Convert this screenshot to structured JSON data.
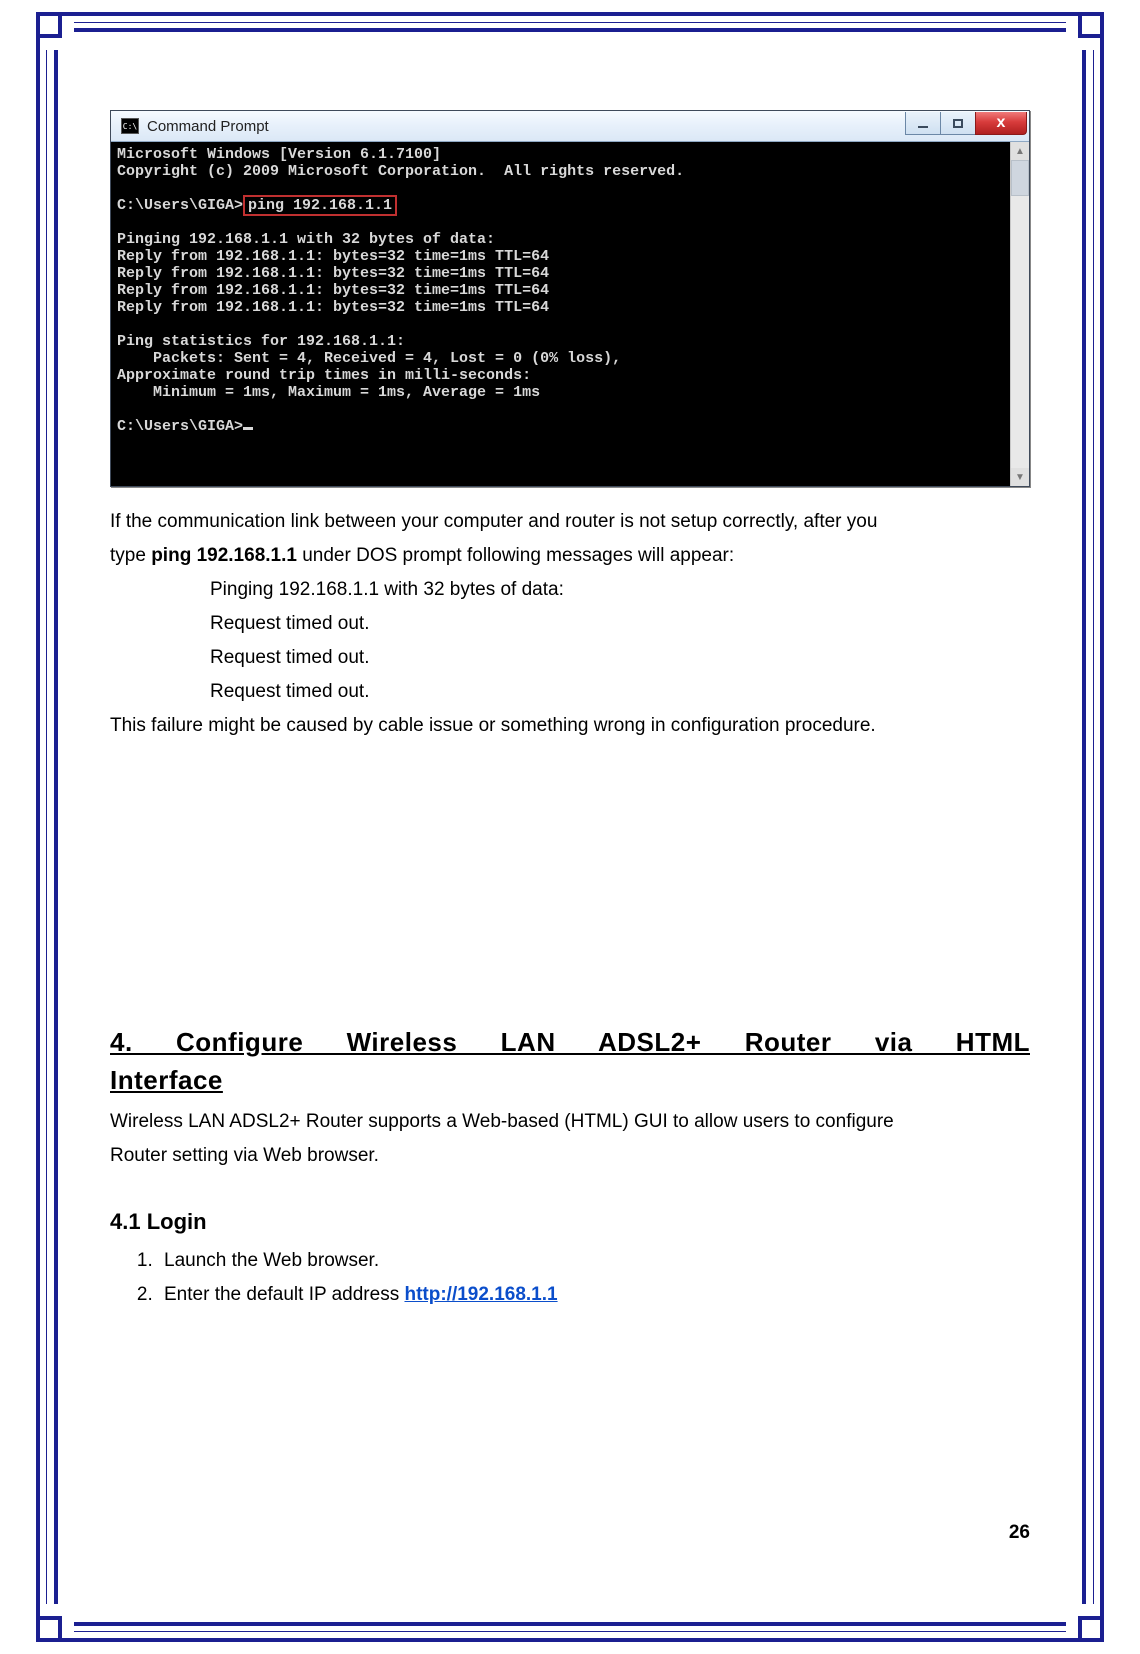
{
  "cmd": {
    "title": "Command Prompt",
    "icon_label": "C:\\",
    "lines": {
      "l1": "Microsoft Windows [Version 6.1.7100]",
      "l2": "Copyright (c) 2009 Microsoft Corporation.  All rights reserved.",
      "l3a": "C:\\Users\\GIGA>",
      "l3b": "ping 192.168.1.1",
      "l4": "Pinging 192.168.1.1 with 32 bytes of data:",
      "l5": "Reply from 192.168.1.1: bytes=32 time=1ms TTL=64",
      "l6": "Reply from 192.168.1.1: bytes=32 time=1ms TTL=64",
      "l7": "Reply from 192.168.1.1: bytes=32 time=1ms TTL=64",
      "l8": "Reply from 192.168.1.1: bytes=32 time=1ms TTL=64",
      "l9": "Ping statistics for 192.168.1.1:",
      "l10": "    Packets: Sent = 4, Received = 4, Lost = 0 (0% loss),",
      "l11": "Approximate round trip times in milli-seconds:",
      "l12": "    Minimum = 1ms, Maximum = 1ms, Average = 1ms",
      "l13": "C:\\Users\\GIGA>"
    }
  },
  "text": {
    "p1a": "If the communication link between your computer and router is not setup correctly, after you",
    "p1b_pre": "type ",
    "p1b_bold": "ping 192.168.1.1",
    "p1b_post": " under DOS prompt following messages will appear:",
    "i1": "Pinging 192.168.1.1 with 32 bytes of data:",
    "i2": "Request timed out.",
    "i3": "Request timed out.",
    "i4": "Request timed out.",
    "p2": "This failure might be caused by cable issue or something wrong in configuration procedure."
  },
  "section4": {
    "heading_l1": "4. Configure Wireless LAN ADSL2+ Router via HTML",
    "heading_l2": "Interface",
    "body1": "Wireless LAN ADSL2+ Router supports a Web-based (HTML) GUI to allow users to configure",
    "body2": "Router setting via Web browser.",
    "sub": "4.1 Login",
    "step1": "Launch the Web browser.",
    "step2_pre": "Enter the default IP address ",
    "step2_link": "http://192.168.1.1"
  },
  "page_number": "26"
}
